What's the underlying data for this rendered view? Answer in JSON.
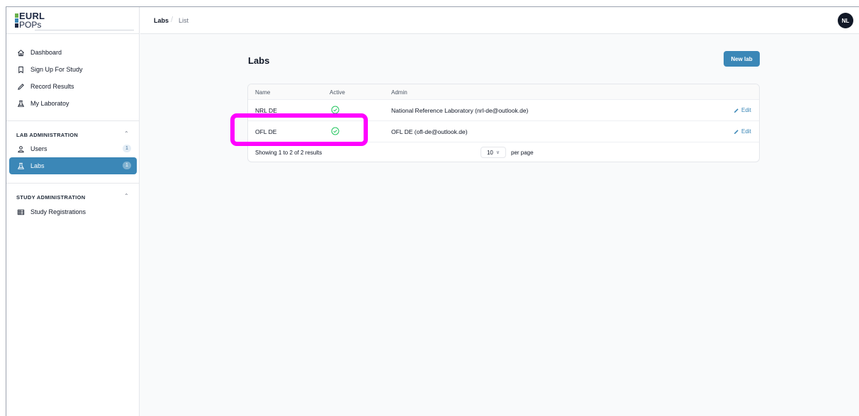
{
  "app": {
    "logo_line1": "EURL",
    "logo_line2": "POPs",
    "logo_colors": [
      "#6ab04c",
      "#3b87b7",
      "#1f2a44"
    ]
  },
  "header": {
    "breadcrumb": [
      "Labs",
      "List"
    ],
    "avatar_initials": "NL"
  },
  "sidebar": {
    "items": [
      {
        "label": "Dashboard",
        "icon": "home-icon"
      },
      {
        "label": "Sign Up For Study",
        "icon": "bookmark-icon"
      },
      {
        "label": "Record Results",
        "icon": "pencil-icon"
      },
      {
        "label": "My Laboratoy",
        "icon": "flask-icon"
      }
    ],
    "lab_admin": {
      "title": "LAB ADMINISTRATION",
      "items": [
        {
          "label": "Users",
          "icon": "users-icon",
          "badge": "1"
        },
        {
          "label": "Labs",
          "icon": "flask-icon",
          "badge": "1",
          "active": true
        }
      ]
    },
    "study_admin": {
      "title": "STUDY ADMINISTRATION",
      "items": [
        {
          "label": "Study Registrations",
          "icon": "table-icon"
        }
      ]
    }
  },
  "main": {
    "title": "Labs",
    "new_button": "New lab",
    "columns": [
      "Name",
      "Active",
      "Admin"
    ],
    "rows": [
      {
        "name": "NRL DE",
        "active": true,
        "admin": "National Reference Laboratory (nrl-de@outlook.de)",
        "edit": "Edit"
      },
      {
        "name": "OFL DE",
        "active": true,
        "admin": "OFL DE (ofl-de@outlook.de)",
        "edit": "Edit"
      }
    ],
    "footer": {
      "showing": "Showing 1 to 2 of 2 results",
      "per_page_value": "10",
      "per_page_label": "per page"
    }
  },
  "colors": {
    "accent": "#3b87b7",
    "active_check": "#22c55e",
    "highlight": "#ff00ff"
  }
}
